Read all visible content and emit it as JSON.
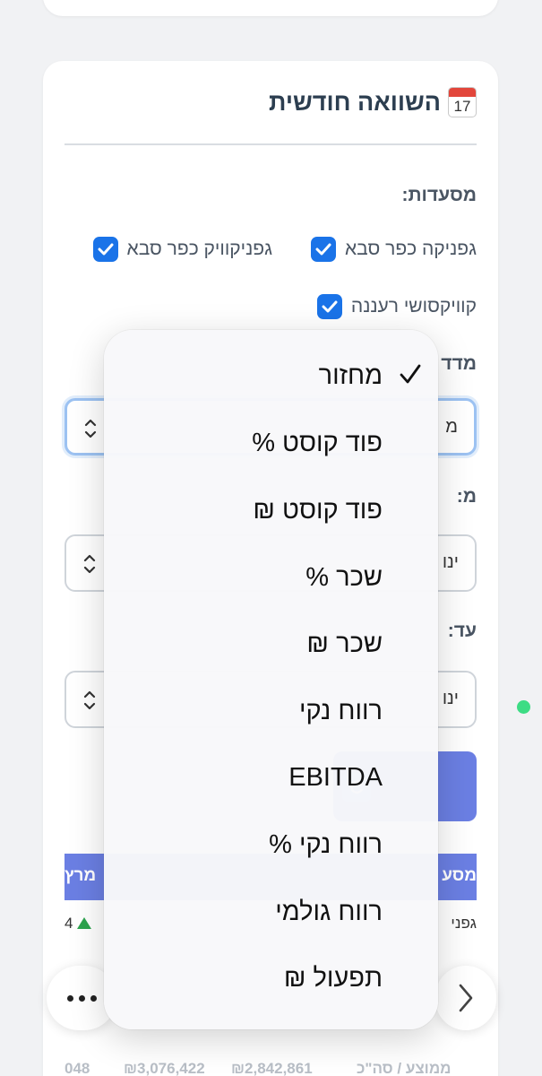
{
  "panel": {
    "title": "השוואה חודשית",
    "calendar_icon": {
      "name": "calendar-icon",
      "month": "JUL",
      "day": "17"
    }
  },
  "restaurants": {
    "label": "מסעדות:",
    "items": [
      {
        "label": "גפניקה כפר סבא",
        "checked": true
      },
      {
        "label": "גפניקוויק כפר סבא",
        "checked": true
      },
      {
        "label": "קוויקסושי רעננה",
        "checked": true
      }
    ]
  },
  "metric": {
    "label_partial": "מדד",
    "value_partial": "מ"
  },
  "from": {
    "label_partial": "מ:",
    "value_partial": "ינו"
  },
  "to": {
    "label_partial": "עד:",
    "value_partial": "ינו"
  },
  "table": {
    "header_left_partial": "מרץ",
    "header_right_partial": "מסע",
    "row1_left_partial": "4",
    "row1_right_partial": "גפני",
    "faded_footer": {
      "label": "ממוצע / סה\"כ",
      "value_1": "₪2,842,861",
      "value_2": "₪3,076,422",
      "value_3": "048"
    }
  },
  "dropdown": {
    "selected": "מחזור",
    "options": [
      "מחזור",
      "פוד קוסט %",
      "פוד קוסט ₪",
      "שכר %",
      "שכר ₪",
      "רווח נקי",
      "EBITDA",
      "רווח נקי %",
      "רווח גולמי",
      "תפעול ₪"
    ]
  },
  "colors": {
    "accent": "#1a73e8",
    "table_header": "#6b7fe3",
    "status_dot": "#3ddc84",
    "up_arrow": "#2ea44f"
  }
}
